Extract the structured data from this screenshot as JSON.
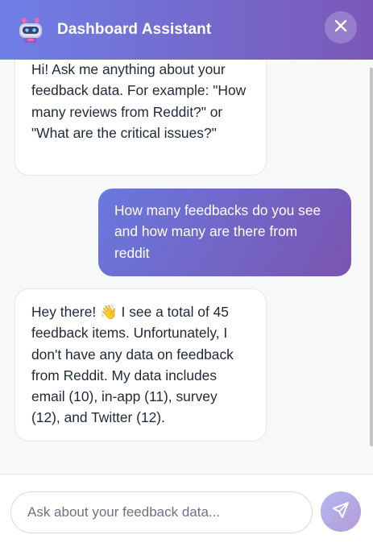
{
  "header": {
    "title": "Dashboard Assistant",
    "bot_icon": "robot-icon",
    "close_icon": "close-icon"
  },
  "messages": [
    {
      "role": "assistant",
      "text": "Hi! Ask me anything about your feedback data. For example: \"How many reviews from Reddit?\" or \"What are the critical issues?\""
    },
    {
      "role": "user",
      "text": "How many feedbacks do you see and how many are there from reddit"
    },
    {
      "role": "assistant",
      "text": "Hey there! 👋 I see a total of 45 feedback items. Unfortunately, I don't have any data on feedback from Reddit. My data includes email (10), in-app (11), survey (12), and Twitter (12)."
    }
  ],
  "composer": {
    "placeholder": "Ask about your feedback data...",
    "value": "",
    "send_icon": "send-icon"
  },
  "colors": {
    "header_gradient_start": "#6f7fe6",
    "header_gradient_end": "#7a58b8",
    "user_bubble_start": "#6a78de",
    "user_bubble_end": "#7a55b0",
    "send_button": "#b3b8ee"
  }
}
